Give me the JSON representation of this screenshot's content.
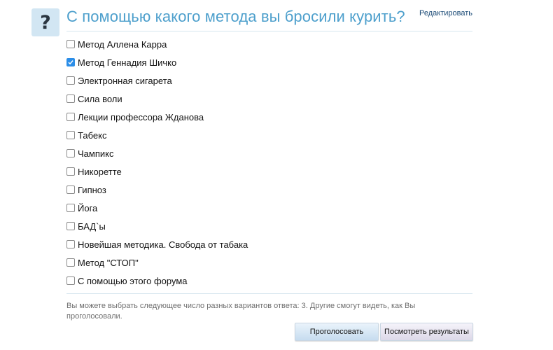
{
  "poll": {
    "icon_glyph": "?",
    "title": "С помощью какого метода вы бросили курить?",
    "edit_label": "Редактировать",
    "options": [
      {
        "label": "Метод Аллена Карра",
        "checked": false
      },
      {
        "label": "Метод Геннадия Шичко",
        "checked": true
      },
      {
        "label": "Электронная сигарета",
        "checked": false
      },
      {
        "label": "Сила воли",
        "checked": false
      },
      {
        "label": "Лекции профессора Жданова",
        "checked": false
      },
      {
        "label": "Табекс",
        "checked": false
      },
      {
        "label": "Чампикс",
        "checked": false
      },
      {
        "label": "Никоретте",
        "checked": false
      },
      {
        "label": "Гипноз",
        "checked": false
      },
      {
        "label": "Йога",
        "checked": false
      },
      {
        "label": "БАД`ы",
        "checked": false
      },
      {
        "label": "Новейшая методика. Свобода от табака",
        "checked": false
      },
      {
        "label": "Метод \"СТОП\"",
        "checked": false
      },
      {
        "label": "С помощью этого форума",
        "checked": false
      }
    ],
    "note": "Вы можете выбрать следующее число разных вариантов ответа: 3. Другие смогут видеть, как Вы проголосовали.",
    "vote_label": "Проголосовать",
    "results_label": "Посмотреть результаты"
  },
  "colors": {
    "title": "#4d9fcc",
    "icon_bg": "#d2e6f3",
    "checkbox_checked": "#2c8ee8",
    "link": "#1a4a76"
  },
  "icons": {
    "question": "question-mark-icon",
    "check": "checkmark-icon"
  }
}
